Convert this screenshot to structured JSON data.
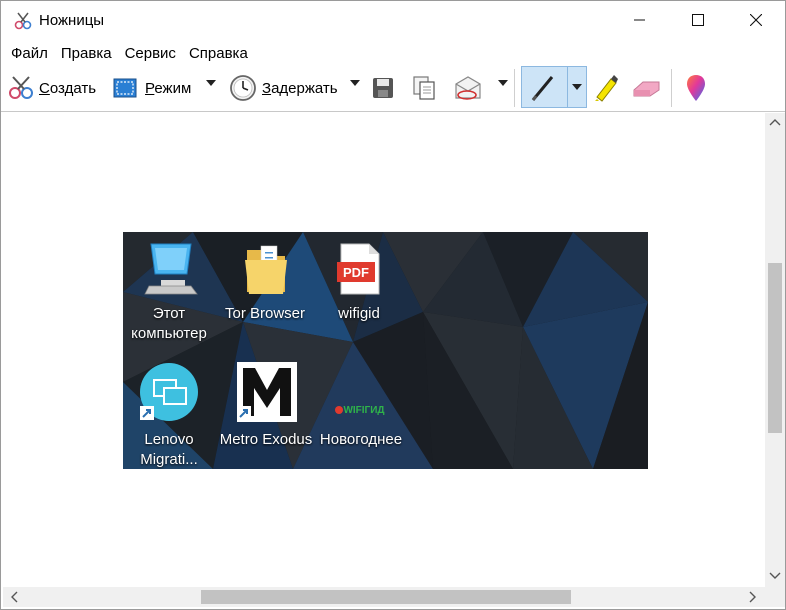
{
  "window": {
    "title": "Ножницы"
  },
  "menu": [
    "Файл",
    "Правка",
    "Сервис",
    "Справка"
  ],
  "toolbar": {
    "new_label": "Создать",
    "new_underline": "С",
    "new_rest": "оздать",
    "mode_label": "Режим",
    "mode_underline": "Р",
    "mode_rest": "ежим",
    "delay_label": "Задержать",
    "delay_underline": "З",
    "delay_rest": "адержать"
  },
  "desktop_icons": [
    {
      "line1": "Этот",
      "line2": "компьютер",
      "icon": "computer-icon"
    },
    {
      "line1": "Tor Browser",
      "line2": "",
      "icon": "folder-icon"
    },
    {
      "line1": "wifigid",
      "line2": "",
      "icon": "pdf-icon"
    },
    {
      "line1": "Lenovo",
      "line2": "Migrati...",
      "icon": "lenovo-icon"
    },
    {
      "line1": "Metro Exodus",
      "line2": "",
      "icon": "metro-icon"
    },
    {
      "line1": "Новогоднее",
      "line2": "",
      "icon": "wifigid-logo-icon"
    }
  ],
  "logo_text": "WIFIГИД",
  "pdf_text": "PDF",
  "colors": {
    "pen_highlight": "#cde4f7",
    "desktop_bg": "#1a1d22",
    "accent": "#2a7fd4"
  }
}
